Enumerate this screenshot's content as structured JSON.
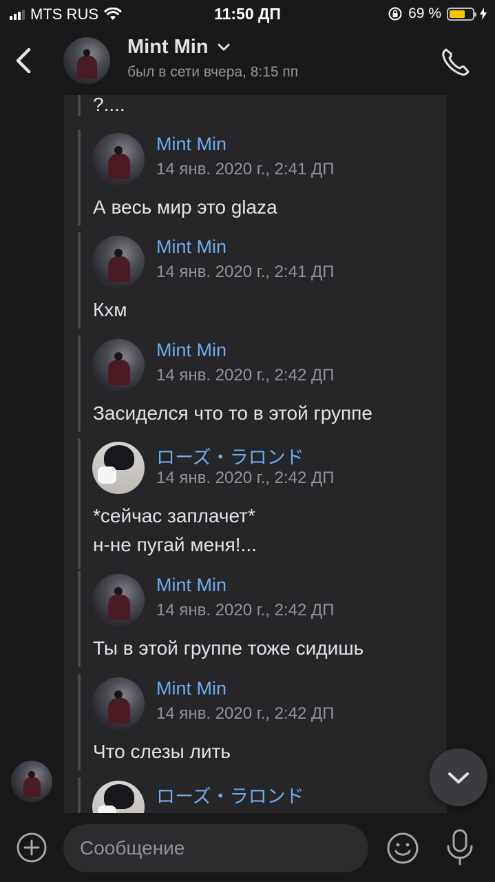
{
  "status_bar": {
    "carrier": "MTS RUS",
    "time": "11:50 ДП",
    "battery_percent": "69 %",
    "battery_level": 0.69
  },
  "header": {
    "back_icon": "chevron-left-icon",
    "name": "Mint Min",
    "status": "был в сети вчера, 8:15 пп",
    "call_icon": "phone-icon"
  },
  "forwarded": {
    "top_fragment": "?....",
    "messages": [
      {
        "author": "Mint Min",
        "date": "14 янв. 2020 г., 2:41 ДП",
        "lines": [
          "А весь мир это glaza"
        ],
        "avatar": "mint"
      },
      {
        "author": "Mint Min",
        "date": "14 янв. 2020 г., 2:41 ДП",
        "lines": [
          "Кхм"
        ],
        "avatar": "mint"
      },
      {
        "author": "Mint Min",
        "date": "14 янв. 2020 г., 2:42 ДП",
        "lines": [
          "Засиделся что то в этой группе"
        ],
        "avatar": "mint"
      },
      {
        "author": "ローズ・ラロンド",
        "date": "14 янв. 2020 г., 2:42 ДП",
        "lines": [
          "*сейчас заплачет*",
          "н-не пугай меня!..."
        ],
        "avatar": "rose"
      },
      {
        "author": "Mint Min",
        "date": "14 янв. 2020 г., 2:42 ДП",
        "lines": [
          "Ты в этой группе тоже сидишь"
        ],
        "avatar": "mint"
      },
      {
        "author": "Mint Min",
        "date": "14 янв. 2020 г., 2:42 ДП",
        "lines": [
          "Что слезы лить"
        ],
        "avatar": "mint"
      },
      {
        "author": "ローズ・ラロンド",
        "date": "",
        "lines": [],
        "avatar": "rose"
      }
    ]
  },
  "composer": {
    "placeholder": "Сообщение",
    "value": ""
  },
  "colors": {
    "background": "#19191a",
    "bubble": "#262628",
    "author": "#71aaeb",
    "muted": "#8f9399",
    "text": "#e1e3e6"
  }
}
